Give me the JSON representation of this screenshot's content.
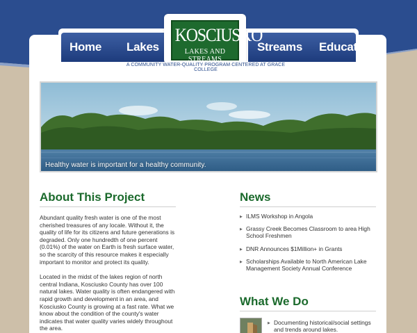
{
  "nav": {
    "left": [
      "Home",
      "Lakes"
    ],
    "right": [
      "Streams",
      "Education"
    ]
  },
  "logo": {
    "main": "KOSCIUSKO",
    "sub": "LAKES AND STREAMS"
  },
  "tagline": "A COMMUNITY WATER-QUALITY PROGRAM CENTERED AT GRACE COLLEGE",
  "hero": {
    "caption": "Healthy water is important for a healthy community."
  },
  "about": {
    "title": "About This Project",
    "paragraphs": [
      "Abundant quality fresh water is one of the most cherished treasures of any locale.  Without it, the quality of life for its citizens and future generations is degraded.  Only one hundredth of one percent (0.01%) of the water on Earth is fresh surface water, so the scarcity of this resource makes it especially important to monitor and protect its quality.",
      "Located in the midst of the lakes region of north central Indiana, Kosciusko County has over 100 natural lakes.  Water quality is often endangered with rapid growth and development in an area, and Kosciusko County is growing at a fast rate.  What we know about the condition of the county's water indicates that water quality varies widely throughout the area."
    ]
  },
  "news": {
    "title": "News",
    "items": [
      "ILMS Workshop in Angola",
      "Grassy Creek Becomes Classroom to area High School Freshmen",
      "DNR Announces $1Million+ in Grants",
      "Scholarships Available to North American Lake Management Society Annual Conference"
    ]
  },
  "whatwedo": {
    "title": "What We Do",
    "items": [
      "Documenting historical/social settings and trends around lakes."
    ]
  },
  "colors": {
    "nav_blue": "#1d3b7c",
    "brand_green": "#1e6a2e",
    "heading_green": "#1b6a2c",
    "background_tan": "#cdbfa9"
  }
}
